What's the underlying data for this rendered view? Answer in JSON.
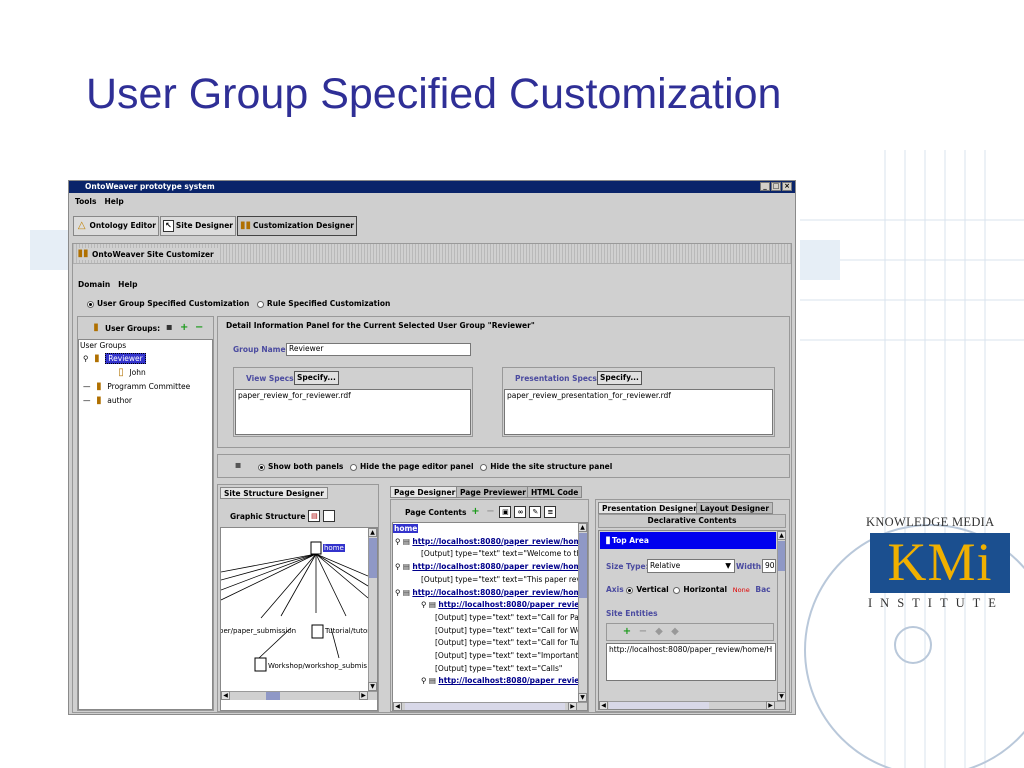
{
  "slide": {
    "title": "User Group Specified Customization"
  },
  "kmi": {
    "top": "KNOWLEDGE MEDIA",
    "logo": "KMi",
    "bottom": "INSTITUTE"
  },
  "window": {
    "title": "OntoWeaver prototype system",
    "controls": [
      "_",
      "□",
      "×"
    ],
    "menu": [
      "Tools",
      "Help"
    ],
    "toolbar": [
      "Ontology Editor",
      "Site Designer",
      "Customization Designer"
    ]
  },
  "customizer": {
    "title": "OntoWeaver Site Customizer",
    "menu": [
      "Domain",
      "Help"
    ],
    "modes": [
      "User Group Specified Customization",
      "Rule Specified Customization"
    ],
    "groups_label": "User Groups:",
    "tree": {
      "root": "User Groups",
      "items": [
        {
          "label": "Reviewer",
          "selected": true
        },
        {
          "label": "John"
        },
        {
          "label": "Programm Committee"
        },
        {
          "label": "author"
        }
      ]
    },
    "detail": {
      "title": "Detail Information Panel for the Current Selected User Group \"Reviewer\"",
      "group_name_label": "Group Name:",
      "group_name_value": "Reviewer",
      "view_specs_label": "View Specs",
      "view_specs_button": "Specify...",
      "view_specs_value": "paper_review_for_reviewer.rdf",
      "pres_specs_label": "Presentation Specs",
      "pres_specs_button": "Specify...",
      "pres_specs_value": "paper_review_presentation_for_reviewer.rdf"
    },
    "panel_options": [
      "Show both panels",
      "Hide the page editor panel",
      "Hide the site structure panel"
    ],
    "site_structure": {
      "tab": "Site Structure Designer",
      "graphic_label": "Graphic Structure",
      "nodes": {
        "home": "home",
        "left": "per/paper_submission",
        "mid": "Tutorial/tutori",
        "bottom": "Workshop/workshop_submis"
      }
    },
    "page_designer": {
      "tabs": [
        "Page Designer",
        "Page Previewer",
        "HTML Code"
      ],
      "contents_label": "Page Contents",
      "lines": [
        {
          "text": "home",
          "kind": "root"
        },
        {
          "text": "http://localhost:8080/paper_review/hom",
          "kind": "link",
          "indent": 1
        },
        {
          "text": "[Output] type=\"text\"  text=\"Welcome to the",
          "kind": "out",
          "indent": 2
        },
        {
          "text": "http://localhost:8080/paper_review/hom",
          "kind": "link",
          "indent": 1
        },
        {
          "text": "[Output] type=\"text\"  text=\"This paper revie",
          "kind": "out",
          "indent": 2
        },
        {
          "text": "http://localhost:8080/paper_review/hom",
          "kind": "link",
          "indent": 1
        },
        {
          "text": "http://localhost:8080/paper_review/l",
          "kind": "link",
          "indent": 2
        },
        {
          "text": "[Output] type=\"text\"  text=\"Call for Pape",
          "kind": "out",
          "indent": 3
        },
        {
          "text": "[Output] type=\"text\"  text=\"Call for Worl",
          "kind": "out",
          "indent": 3
        },
        {
          "text": "[Output] type=\"text\"  text=\"Call for Tuto",
          "kind": "out",
          "indent": 3
        },
        {
          "text": "[Output] type=\"text\"  text=\"Important D",
          "kind": "out",
          "indent": 3
        },
        {
          "text": "[Output] type=\"text\"  text=\"Calls\"",
          "kind": "out",
          "indent": 3
        },
        {
          "text": "http://localhost:8080/paper_review/l",
          "kind": "link",
          "indent": 2
        }
      ]
    },
    "presentation": {
      "tabs": [
        "Presentation Designer",
        "Layout Designer"
      ],
      "declarative": "Declarative Contents",
      "top_area": "Top Area",
      "size_type_label": "Size Type:",
      "size_type_value": "Relative",
      "width_label": "Width:",
      "width_value": "90",
      "axis_label": "Axis",
      "axis_options": [
        "Vertical",
        "Horizontal"
      ],
      "none_label": "None",
      "bac_label": "Bac",
      "site_entities": "Site Entities",
      "entity_url": "http://localhost:8080/paper_review/home/H"
    }
  }
}
